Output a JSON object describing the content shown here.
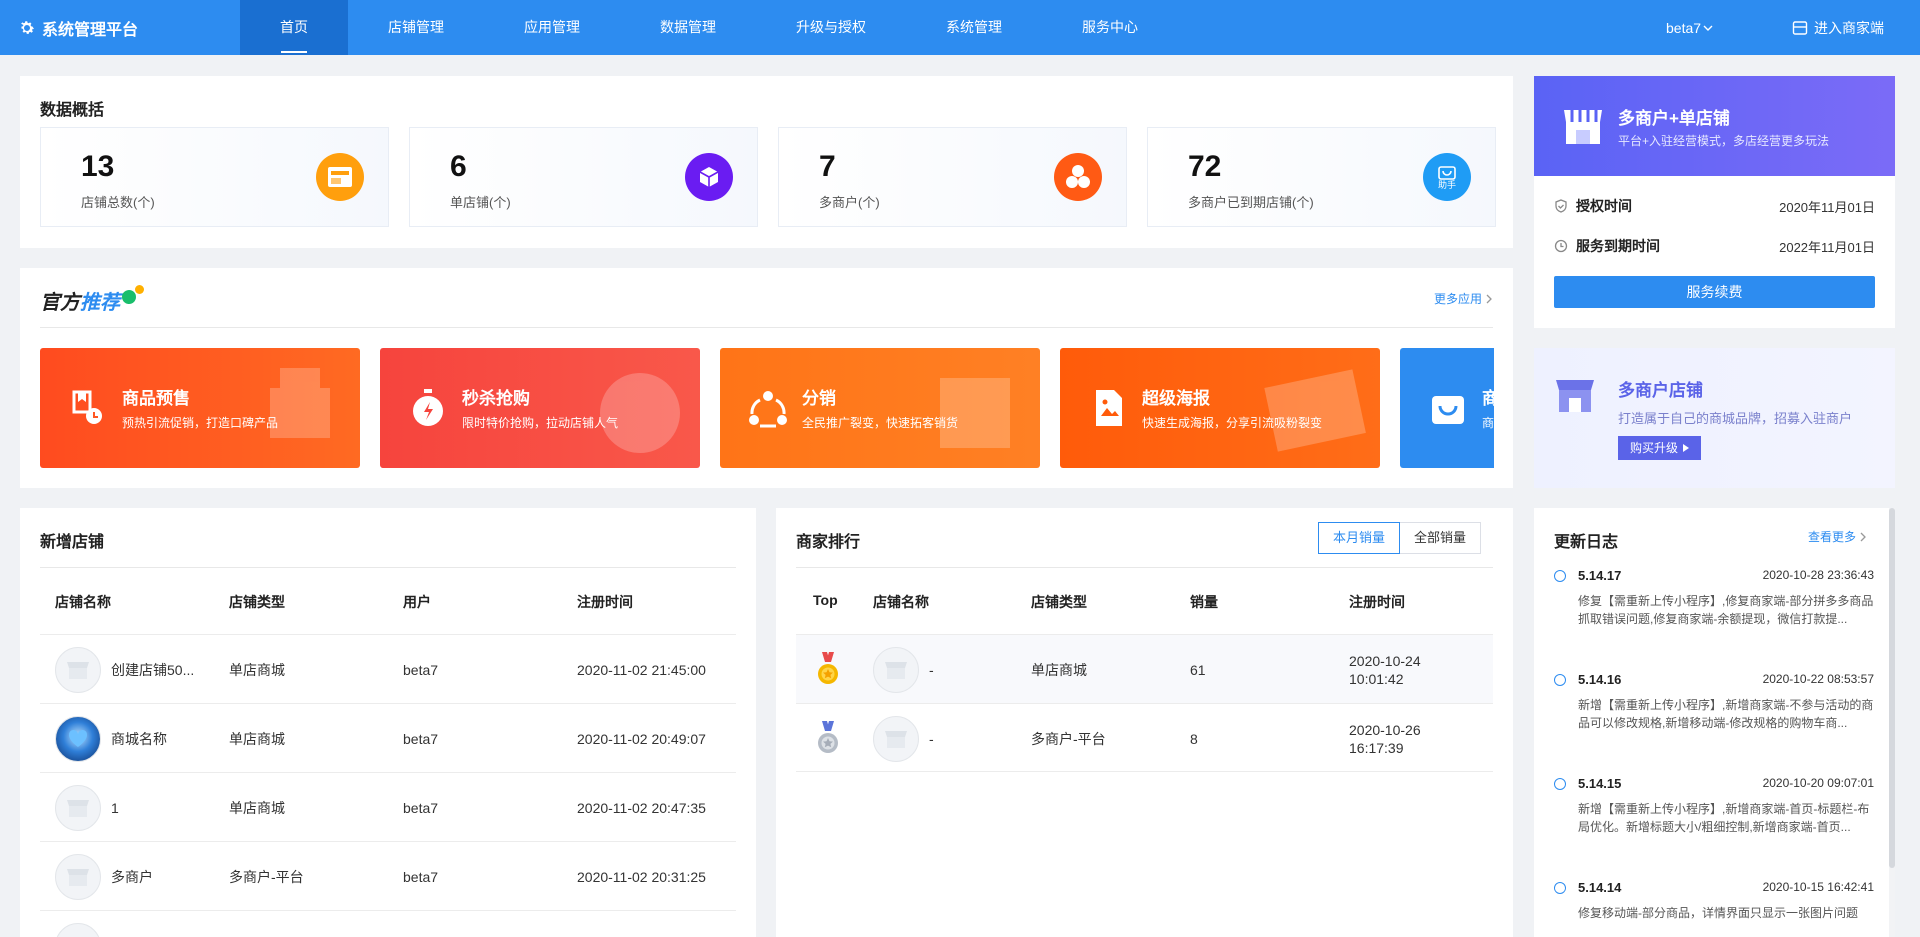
{
  "header": {
    "brand": "系统管理平台",
    "nav": [
      "首页",
      "店铺管理",
      "应用管理",
      "数据管理",
      "升级与授权",
      "系统管理",
      "服务中心"
    ],
    "user": "beta7",
    "enter_merchant": "进入商家端"
  },
  "overview": {
    "title": "数据概括",
    "cards": [
      {
        "value": "13",
        "label": "店铺总数(个)",
        "color": "#ff9f0d",
        "icon": "store-icon"
      },
      {
        "value": "6",
        "label": "单店铺(个)",
        "color": "#6a1cf2",
        "icon": "cube-icon"
      },
      {
        "value": "7",
        "label": "多商户(个)",
        "color": "#ff5a14",
        "icon": "hexagons-icon"
      },
      {
        "value": "72",
        "label": "多商户已到期店铺(个)",
        "color": "#1f9cf5",
        "icon": "assistant-bag-icon",
        "badge": "助手"
      }
    ]
  },
  "recommend": {
    "title_a": "官方",
    "title_b": "推荐",
    "more": "更多应用",
    "tiles": [
      {
        "title": "商品预售",
        "desc": "预热引流促销，打造口碑产品",
        "color": "#ff5722"
      },
      {
        "title": "秒杀抢购",
        "desc": "限时特价抢购，拉动店铺人气",
        "color": "#f74a44"
      },
      {
        "title": "分销",
        "desc": "全民推广裂变，快速拓客销货",
        "color": "#ff7a1c"
      },
      {
        "title": "超级海报",
        "desc": "快速生成海报，分享引流吸粉裂变",
        "color": "#ff6110"
      },
      {
        "title": "商",
        "desc": "商",
        "color": "#2d8cf0"
      }
    ]
  },
  "license": {
    "banner_title": "多商户+单店铺",
    "banner_desc": "平台+入驻经营模式，多店经营更多玩法",
    "auth_label": "授权时间",
    "auth_date": "2020年11月01日",
    "expire_label": "服务到期时间",
    "expire_date": "2022年11月01日",
    "renew": "服务续费"
  },
  "multi_store": {
    "title": "多商户店铺",
    "desc": "打造属于自己的商城品牌，招募入驻商户",
    "button": "购买升级"
  },
  "new_stores": {
    "title": "新增店铺",
    "columns": [
      "店铺名称",
      "店铺类型",
      "用户",
      "注册时间"
    ],
    "rows": [
      {
        "name": "创建店铺50...",
        "type": "单店商城",
        "user": "beta7",
        "time": "2020-11-02 21:45:00"
      },
      {
        "name": "商城名称",
        "type": "单店商城",
        "user": "beta7",
        "time": "2020-11-02 20:49:07"
      },
      {
        "name": "1",
        "type": "单店商城",
        "user": "beta7",
        "time": "2020-11-02 20:47:35"
      },
      {
        "name": "多商户",
        "type": "多商户-平台",
        "user": "beta7",
        "time": "2020-11-02 20:31:25"
      }
    ]
  },
  "ranking": {
    "title": "商家排行",
    "tab_month": "本月销量",
    "tab_all": "全部销量",
    "columns": [
      "Top",
      "店铺名称",
      "店铺类型",
      "销量",
      "注册时间"
    ],
    "rows": [
      {
        "name": "-",
        "type": "单店商城",
        "sales": "61",
        "date": "2020-10-24",
        "time": "10:01:42"
      },
      {
        "name": "-",
        "type": "多商户-平台",
        "sales": "8",
        "date": "2020-10-26",
        "time": "16:17:39"
      }
    ]
  },
  "changelog": {
    "title": "更新日志",
    "more": "查看更多",
    "items": [
      {
        "version": "5.14.17",
        "time": "2020-10-28 23:36:43",
        "text": "修复【需重新上传小程序】,修复商家端-部分拼多多商品抓取错误问题,修复商家端-余额提现，微信打款提..."
      },
      {
        "version": "5.14.16",
        "time": "2020-10-22 08:53:57",
        "text": "新增【需重新上传小程序】,新增商家端-不参与活动的商品可以修改规格,新增移动端-修改规格的购物车商..."
      },
      {
        "version": "5.14.15",
        "time": "2020-10-20 09:07:01",
        "text": "新增【需重新上传小程序】,新增商家端-首页-标题栏-布局优化。新增标题大小/粗细控制,新增商家端-首页..."
      },
      {
        "version": "5.14.14",
        "time": "2020-10-15 16:42:41",
        "text": "修复移动端-部分商品，详情界面只显示一张图片问题"
      }
    ]
  }
}
